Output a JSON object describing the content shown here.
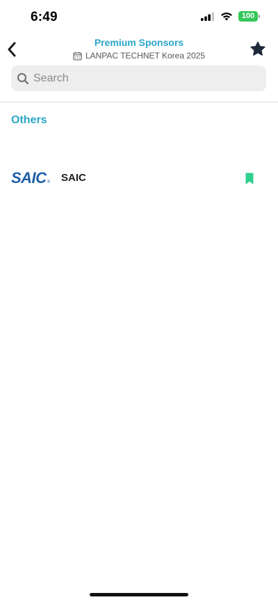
{
  "status_bar": {
    "time": "6:49",
    "battery": "100"
  },
  "header": {
    "title": "Premium Sponsors",
    "event": "LANPAC TECHNET Korea 2025",
    "back_icon": "chevron-left-icon",
    "favorite_icon": "star-icon"
  },
  "search": {
    "placeholder": "Search",
    "value": ""
  },
  "section": {
    "title": "Others"
  },
  "sponsors": [
    {
      "logo_text": "SAIC",
      "logo_mark": "®",
      "name": "SAIC",
      "bookmark_icon": "bookmark-icon"
    }
  ],
  "colors": {
    "accent": "#2ba6c9",
    "bookmark": "#2fcf8c",
    "logo": "#1f5fa8",
    "battery": "#34c759"
  }
}
